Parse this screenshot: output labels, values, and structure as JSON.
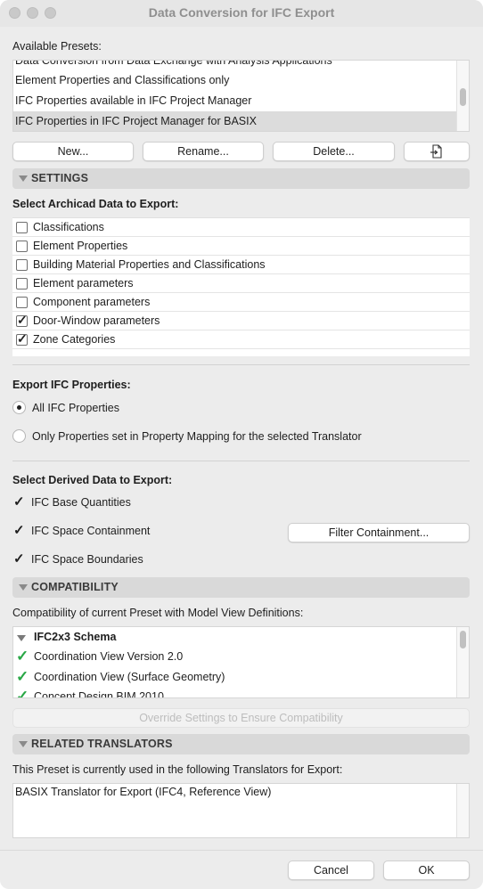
{
  "window": {
    "title": "Data Conversion for IFC Export"
  },
  "presets": {
    "label": "Available Presets:",
    "items": [
      "Data Conversion from Data Exchange with Analysis Applications",
      "Element Properties and Classifications only",
      "IFC Properties available in IFC Project Manager",
      "IFC Properties in IFC Project Manager for BASIX"
    ],
    "selected_index": 3
  },
  "buttons": {
    "new": "New...",
    "rename": "Rename...",
    "delete": "Delete...",
    "import_icon": "import-icon",
    "filter_containment": "Filter Containment...",
    "override": "Override Settings to Ensure Compatibility",
    "cancel": "Cancel",
    "ok": "OK"
  },
  "settings": {
    "title": "SETTINGS",
    "archicad_label": "Select Archicad Data to Export:",
    "archicad_items": [
      {
        "label": "Classifications",
        "checked": false
      },
      {
        "label": "Element Properties",
        "checked": false
      },
      {
        "label": "Building Material Properties and Classifications",
        "checked": false
      },
      {
        "label": "Element parameters",
        "checked": false
      },
      {
        "label": "Component parameters",
        "checked": false
      },
      {
        "label": "Door-Window parameters",
        "checked": true
      },
      {
        "label": "Zone Categories",
        "checked": true
      }
    ],
    "ifc_props_label": "Export IFC Properties:",
    "ifc_props_options": [
      {
        "label": "All IFC Properties",
        "selected": true
      },
      {
        "label": "Only Properties set in Property Mapping for the selected Translator",
        "selected": false
      }
    ],
    "derived_label": "Select Derived Data to Export:",
    "derived_items": [
      {
        "label": "IFC Base Quantities",
        "checked": true
      },
      {
        "label": "IFC Space Containment",
        "checked": true
      },
      {
        "label": "IFC Space Boundaries",
        "checked": true
      }
    ]
  },
  "compatibility": {
    "title": "COMPATIBILITY",
    "description": "Compatibility of current Preset with Model View Definitions:",
    "schema": "IFC2x3 Schema",
    "items": [
      "Coordination View Version 2.0",
      "Coordination View (Surface Geometry)",
      "Concept Design BIM 2010"
    ],
    "check_color": "#28a745"
  },
  "related": {
    "title": "RELATED TRANSLATORS",
    "description": "This Preset is currently used in the following Translators for Export:",
    "items": [
      "BASIX Translator for Export (IFC4, Reference View)"
    ]
  }
}
